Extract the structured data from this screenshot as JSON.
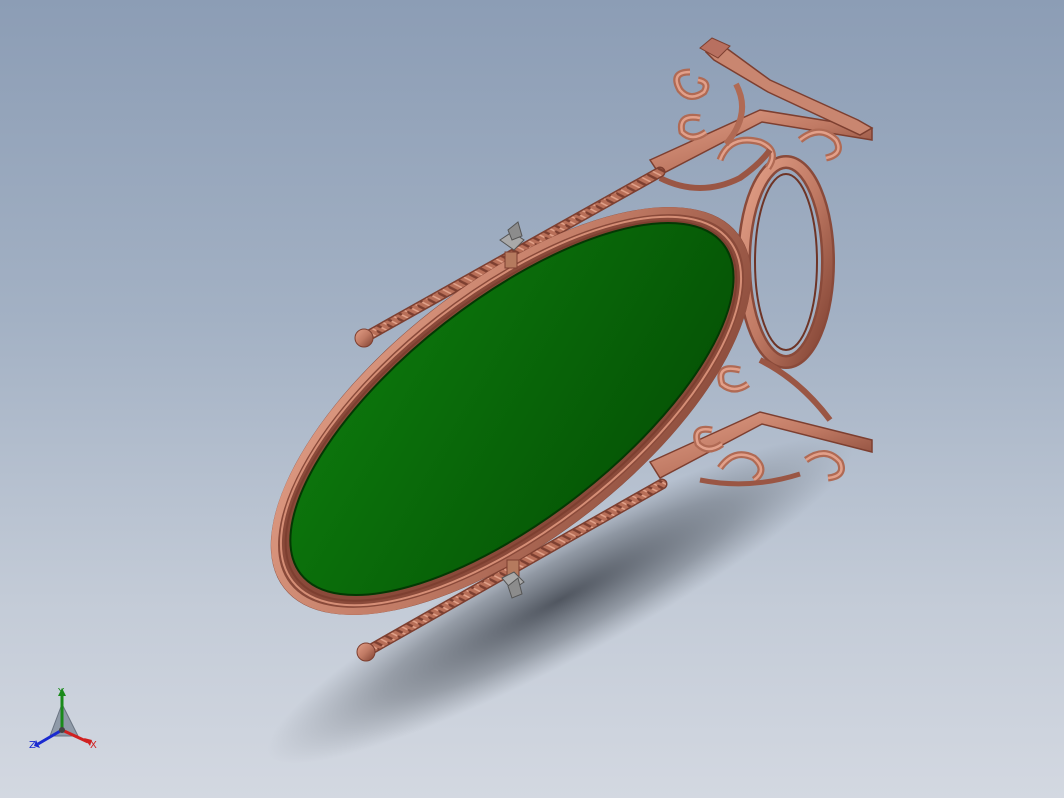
{
  "viewport": {
    "background_top": "#8c9db5",
    "background_bottom": "#d3d8e1"
  },
  "model": {
    "metal_color": "#c07a64",
    "metal_dark": "#8a4a3a",
    "panel_color": "#0b6b0b",
    "panel_dark": "#064406",
    "hardware_color": "#9a9a9a"
  },
  "triad": {
    "x_label": "X",
    "y_label": "Y",
    "z_label": "Z",
    "x_color": "#d02020",
    "y_color": "#1a8a1a",
    "z_color": "#1a2ad0"
  }
}
